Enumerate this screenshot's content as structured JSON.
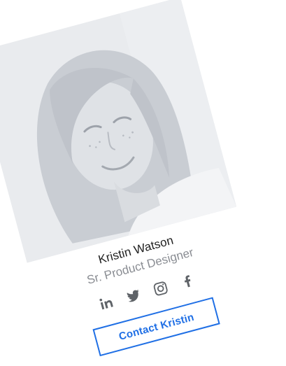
{
  "profile": {
    "photo_alt": "Kristin Watson",
    "name": "Kristin Watson",
    "role": "Sr. Product Designer"
  },
  "socials": [
    {
      "icon": "linkedin-icon"
    },
    {
      "icon": "twitter-icon"
    },
    {
      "icon": "instagram-icon"
    },
    {
      "icon": "facebook-icon"
    }
  ],
  "contact_button": {
    "label": "Contact Kristin"
  },
  "colors": {
    "accent": "#1f6fe5",
    "name": "#1f1f1f",
    "role": "#8a8d93",
    "icons": "#5f6368",
    "photo_bg": "#e7e9ec"
  }
}
